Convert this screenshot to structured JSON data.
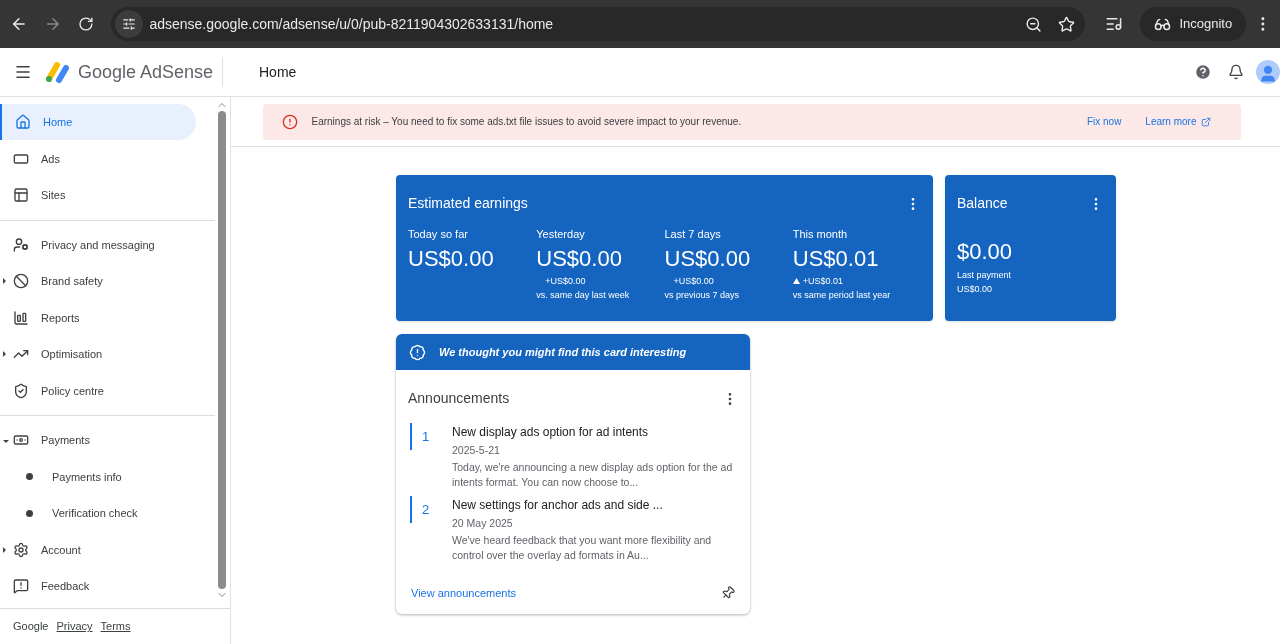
{
  "browser": {
    "url": "adsense.google.com/adsense/u/0/pub-8211904302633131/home",
    "profile": "Incognito"
  },
  "header": {
    "product": "Google AdSense",
    "page_title": "Home"
  },
  "sidebar": {
    "sections": [
      [
        {
          "label": "Home",
          "kind": "link",
          "selected": true
        },
        {
          "label": "Ads",
          "kind": "link",
          "selected": false
        },
        {
          "label": "Sites",
          "kind": "link",
          "selected": false
        }
      ],
      [
        {
          "label": "Privacy and messaging",
          "kind": "link",
          "selected": false
        },
        {
          "label": "Brand safety",
          "kind": "group",
          "expanded": false,
          "selected": false
        },
        {
          "label": "Reports",
          "kind": "link",
          "selected": false
        },
        {
          "label": "Optimisation",
          "kind": "group",
          "expanded": false,
          "selected": false
        },
        {
          "label": "Policy centre",
          "kind": "link",
          "selected": false
        }
      ],
      [
        {
          "label": "Payments",
          "kind": "group",
          "expanded": true,
          "selected": false,
          "children": [
            {
              "label": "Payments info",
              "selected": false
            },
            {
              "label": "Verification check",
              "selected": false
            }
          ]
        },
        {
          "label": "Account",
          "kind": "group",
          "expanded": false,
          "selected": false
        },
        {
          "label": "Feedback",
          "kind": "link",
          "selected": false
        }
      ]
    ],
    "footer": [
      "Google",
      "Privacy",
      "Terms"
    ]
  },
  "alert": {
    "message": "Earnings at risk – You need to fix some ads.txt file issues to avoid severe impact to your revenue.",
    "actions": [
      "Fix now",
      "Learn more"
    ]
  },
  "earnings": {
    "title": "Estimated earnings",
    "metrics": [
      {
        "label": "Today so far",
        "value": "US$0.00"
      },
      {
        "label": "Yesterday",
        "value": "US$0.00",
        "change": "+US$0.00",
        "rising": false,
        "comparison": "vs. same day last week"
      },
      {
        "label": "Last 7 days",
        "value": "US$0.00",
        "change": "+US$0.00",
        "rising": false,
        "comparison": "vs previous 7 days"
      },
      {
        "label": "This month",
        "value": "US$0.01",
        "change": "+US$0.01",
        "rising": true,
        "comparison": "vs same period last year"
      }
    ]
  },
  "balance": {
    "title": "Balance",
    "value": "$0.00",
    "last_payment_label": "Last payment",
    "last_payment": "US$0.00"
  },
  "suggestion": {
    "banner": "We thought you might find this card interesting",
    "title": "Announcements",
    "items": [
      {
        "number": "1",
        "title": "New display ads option for ad intents",
        "date": "2025-5-21",
        "summary": "Today, we're announcing a new display ads option for the ad intents format. You can now choose to..."
      },
      {
        "number": "2",
        "title": "New settings for anchor ads and side ...",
        "date": "20 May 2025",
        "summary": "We've heard feedback that you want more flexibility and control over the overlay ad formats in Au..."
      }
    ],
    "link": "View announcements"
  }
}
